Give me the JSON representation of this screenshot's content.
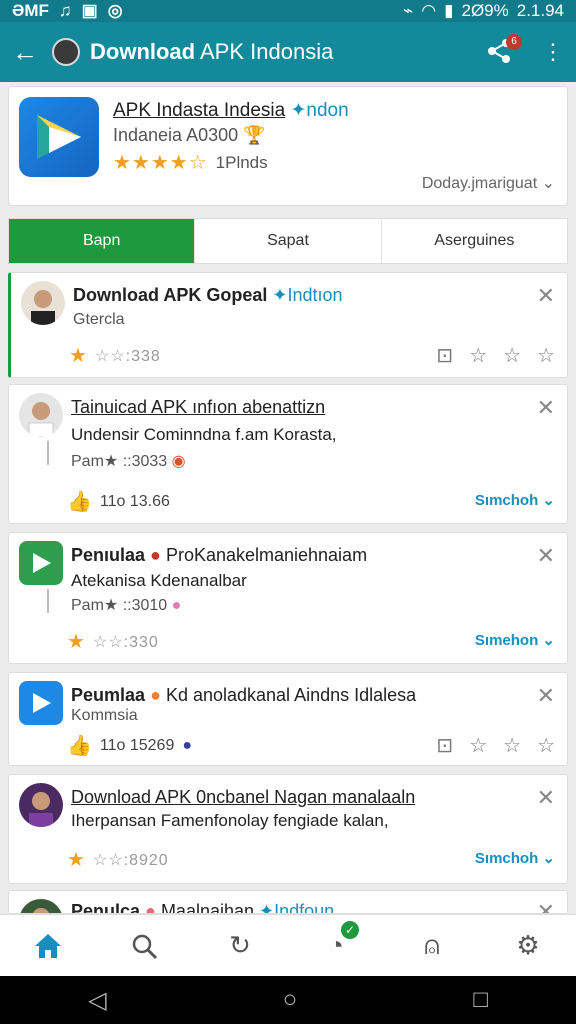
{
  "status": {
    "left": "ƏMF",
    "battery": "2Ø9%",
    "time": "2.1.94"
  },
  "appbar": {
    "title_bold": "Download",
    "title_rest": " APK Indonsia"
  },
  "app": {
    "name": "APK Indasta Indesia",
    "name_tag": "ndon",
    "subtitle": "Indaneia A0300",
    "stars": "★★★★☆",
    "rating_text": "1Plnds",
    "sort": "Doday.jmariguat ⌄"
  },
  "tabs": [
    "Bapn",
    "Sapat",
    "Aserguines"
  ],
  "cards": [
    {
      "title": "Download APK Gopeal",
      "tag": "Indtıon",
      "sub": "Gtercla",
      "meta": "☆☆:338"
    },
    {
      "title": "Tainuicad APK ınfıon abenattizn",
      "line2": "Undensir Cominndna f.am Korasta,",
      "line3": "Pam★ ::3033",
      "meta": "11o 13.66",
      "more": "Sımchoh ⌄"
    },
    {
      "title": "Penıulaa",
      "title_rest": "ProKanakelmaniehnaiam",
      "line2": "Atekanisa Kdenanalbar",
      "line3": "Pam★ ::3010",
      "meta": "☆☆:330",
      "more": "Sımehon ⌄"
    },
    {
      "title": "Peumlaa",
      "title_rest": "Kd anoladkanal Aindns Idlalesa",
      "line2": "Kommsia",
      "meta": "11o 15269"
    },
    {
      "title": "Download APK 0ncbanel Nagan manalaaln",
      "line2": "Iherpansan Famenfonolay fengiade kalan,",
      "meta": "☆☆:8920",
      "more": "Sımchoh ⌄"
    },
    {
      "title": "Penulca",
      "title_rest": "Maalnaihan",
      "tag": "Indfoun"
    }
  ]
}
